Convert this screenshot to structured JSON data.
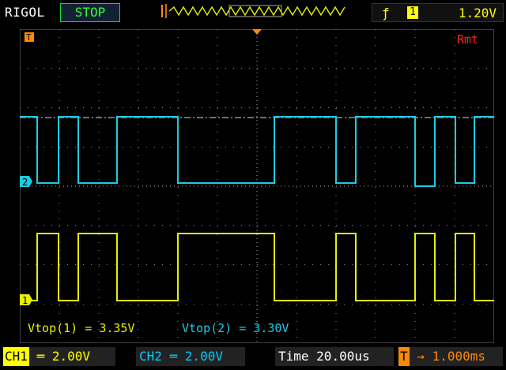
{
  "topbar": {
    "brand": "RIGOL",
    "status": "STOP",
    "trigger_level": "1.20V",
    "trigger_channel": "1"
  },
  "screen": {
    "mode": "Rmt",
    "trigger_pos_marker": "T",
    "ch1_marker": "1",
    "ch2_marker": "2",
    "measurements": [
      {
        "label": "Vtop(1)",
        "value": "3.35V"
      },
      {
        "label": "Vtop(2)",
        "value": "3.30V"
      }
    ]
  },
  "bottombar": {
    "ch1": {
      "label": "CH1",
      "scale": "2.00V"
    },
    "ch2": {
      "label": "CH2",
      "scale": "2.00V"
    },
    "time": {
      "label": "Time",
      "value": "20.00us"
    },
    "offset": {
      "label": "T",
      "value": "1.000ms"
    }
  },
  "colors": {
    "ch1": "#e6f000",
    "ch2": "#1ecbe1",
    "grid": "#888888",
    "status": "#33ff33",
    "mode": "#ff2222"
  }
}
